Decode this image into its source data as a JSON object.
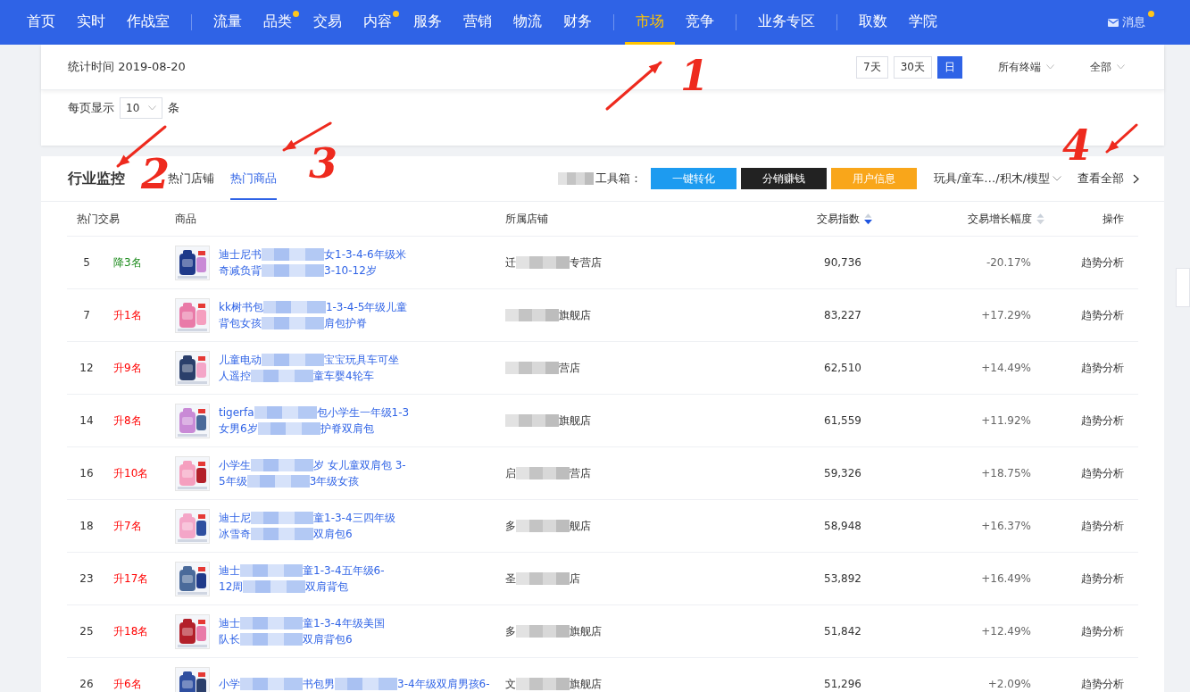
{
  "nav": {
    "groups": [
      [
        {
          "label": "首页",
          "dot": false,
          "selected": false
        },
        {
          "label": "实时",
          "dot": false,
          "selected": false
        },
        {
          "label": "作战室",
          "dot": false,
          "selected": false
        }
      ],
      [
        {
          "label": "流量",
          "dot": false,
          "selected": false
        },
        {
          "label": "品类",
          "dot": true,
          "selected": false
        },
        {
          "label": "交易",
          "dot": false,
          "selected": false
        },
        {
          "label": "内容",
          "dot": true,
          "selected": false
        },
        {
          "label": "服务",
          "dot": false,
          "selected": false
        },
        {
          "label": "营销",
          "dot": false,
          "selected": false
        },
        {
          "label": "物流",
          "dot": false,
          "selected": false
        },
        {
          "label": "财务",
          "dot": false,
          "selected": false
        }
      ],
      [
        {
          "label": "市场",
          "dot": false,
          "selected": true
        },
        {
          "label": "竞争",
          "dot": false,
          "selected": false
        }
      ],
      [
        {
          "label": "业务专区",
          "dot": false,
          "selected": false
        }
      ],
      [
        {
          "label": "取数",
          "dot": false,
          "selected": false
        },
        {
          "label": "学院",
          "dot": false,
          "selected": false
        }
      ]
    ],
    "messages": {
      "label": "消息",
      "dot": true
    }
  },
  "filter_bar": {
    "stat_time": "统计时间 2019-08-20",
    "periods": [
      {
        "label": "7天",
        "selected": false
      },
      {
        "label": "30天",
        "selected": false
      },
      {
        "label": "日",
        "selected": true
      }
    ],
    "dropdowns": [
      "所有终端",
      "全部"
    ],
    "page_size": {
      "prefix": "每页显示",
      "value": "10",
      "suffix": "条"
    }
  },
  "monitor": {
    "title": "行业监控",
    "tabs": [
      {
        "label": "热门店铺",
        "selected": false
      },
      {
        "label": "热门商品",
        "selected": true
      }
    ],
    "toolbox_label": "工具箱：",
    "tools": [
      {
        "label": "一键转化",
        "color": "#1d9bf0"
      },
      {
        "label": "分销赚钱",
        "color": "#222222"
      },
      {
        "label": "用户信息",
        "color": "#f9a61a"
      }
    ],
    "category": "玩具/童车…/积木/模型",
    "view_all": "查看全部",
    "columns": [
      {
        "label": "热门交易"
      },
      {
        "label": "商品"
      },
      {
        "label": "所属店铺"
      },
      {
        "label": "交易指数",
        "sortable": true,
        "sorted": true
      },
      {
        "label": "交易增长幅度",
        "sortable": true,
        "sorted": false
      },
      {
        "label": "操作"
      }
    ],
    "rows": [
      {
        "rank": "5",
        "change": "降3名",
        "rising": false,
        "product": [
          [
            "迪士尼书",
            "女1-3-4-6年级米"
          ],
          [
            "奇减负背",
            "3-10-12岁"
          ]
        ],
        "shop": [
          "迁",
          "专营店"
        ],
        "index": "90,736",
        "growth": "-20.17%",
        "action": "趋势分析"
      },
      {
        "rank": "7",
        "change": "升1名",
        "rising": true,
        "product": [
          [
            "kk树书包",
            "1-3-4-5年级儿童"
          ],
          [
            "背包女孩",
            "肩包护脊"
          ]
        ],
        "shop": [
          "旗舰店"
        ],
        "index": "83,227",
        "growth": "+17.29%",
        "action": "趋势分析"
      },
      {
        "rank": "12",
        "change": "升9名",
        "rising": true,
        "product": [
          [
            "儿童电动",
            "宝宝玩具车可坐"
          ],
          [
            "人遥控",
            "童车婴4轮车"
          ]
        ],
        "shop": [
          "营店"
        ],
        "index": "62,510",
        "growth": "+14.49%",
        "action": "趋势分析"
      },
      {
        "rank": "14",
        "change": "升8名",
        "rising": true,
        "product": [
          [
            "tigerfa",
            "包小学生一年级1-3"
          ],
          [
            "女男6岁",
            "护脊双肩包"
          ]
        ],
        "shop": [
          "旗舰店"
        ],
        "index": "61,559",
        "growth": "+11.92%",
        "action": "趋势分析"
      },
      {
        "rank": "16",
        "change": "升10名",
        "rising": true,
        "product": [
          [
            "小学生",
            "岁 女儿童双肩包 3-"
          ],
          [
            "5年级",
            "3年级女孩"
          ]
        ],
        "shop": [
          "启",
          "营店"
        ],
        "index": "59,326",
        "growth": "+18.75%",
        "action": "趋势分析"
      },
      {
        "rank": "18",
        "change": "升7名",
        "rising": true,
        "product": [
          [
            "迪士尼",
            "童1-3-4三四年级"
          ],
          [
            "冰雪奇",
            "双肩包6"
          ]
        ],
        "shop": [
          "多",
          "舰店"
        ],
        "index": "58,948",
        "growth": "+16.37%",
        "action": "趋势分析"
      },
      {
        "rank": "23",
        "change": "升17名",
        "rising": true,
        "product": [
          [
            "迪士",
            "童1-3-4五年级6-"
          ],
          [
            "12周",
            "双肩背包"
          ]
        ],
        "shop": [
          "圣",
          "店"
        ],
        "index": "53,892",
        "growth": "+16.49%",
        "action": "趋势分析"
      },
      {
        "rank": "25",
        "change": "升18名",
        "rising": true,
        "product": [
          [
            "迪士",
            "童1-3-4年级美国"
          ],
          [
            "队长",
            "双肩背包6"
          ]
        ],
        "shop": [
          "多",
          "旗舰店"
        ],
        "index": "51,842",
        "growth": "+12.49%",
        "action": "趋势分析"
      },
      {
        "rank": "26",
        "change": "升6名",
        "rising": true,
        "product": [
          [
            "小学",
            "书包男",
            "3-4年级双肩男孩6-"
          ]
        ],
        "shop": [
          "文",
          "旗舰店"
        ],
        "index": "51,296",
        "growth": "+2.09%",
        "action": "趋势分析"
      }
    ]
  },
  "annotations": [
    {
      "label": "1"
    },
    {
      "label": "2"
    },
    {
      "label": "3"
    },
    {
      "label": "4"
    }
  ]
}
